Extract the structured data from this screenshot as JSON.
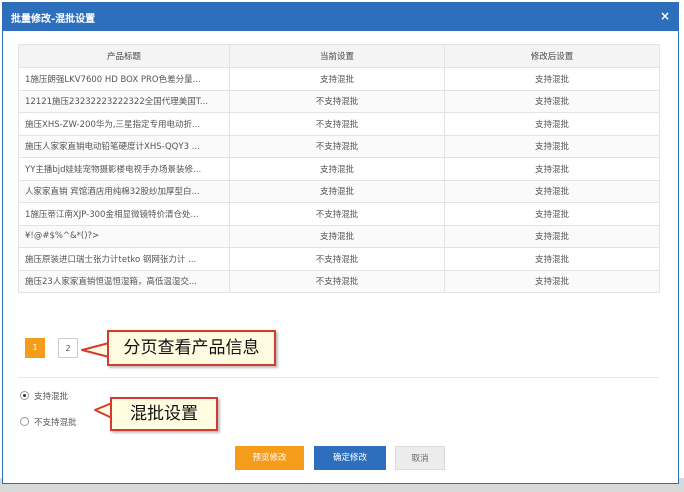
{
  "dialog": {
    "title": "批量修改-混批设置",
    "close_icon": "×"
  },
  "table": {
    "headers": [
      "产品标题",
      "当前设置",
      "修改后设置"
    ],
    "rows": [
      [
        "1施压朗强LKV7600 HD BOX PRO色差分量...",
        "支持混批",
        "支持混批"
      ],
      [
        "12121施压23232223222322全国代理美国T...",
        "不支持混批",
        "支持混批"
      ],
      [
        "施压XHS-ZW-200华为,三星指定专用电动折...",
        "不支持混批",
        "支持混批"
      ],
      [
        "施压人家家直销电动铅笔硬度计XHS-QQY3 ...",
        "不支持混批",
        "支持混批"
      ],
      [
        "YY主播bjd娃娃宠物摄影楼电视手办场景装修...",
        "支持混批",
        "支持混批"
      ],
      [
        "人家家直销 宾馆酒店用纯棉32股纱加厚型白...",
        "支持混批",
        "支持混批"
      ],
      [
        "1施压蒂江南XJP-300金相显微镜特价清仓处...",
        "不支持混批",
        "支持混批"
      ],
      [
        "¥!@#$%^&*()?>",
        "支持混批",
        "支持混批"
      ],
      [
        "施压原装进口瑞士张力计tetko 钢网张力计 ...",
        "不支持混批",
        "支持混批"
      ],
      [
        "施压23人家家直销恒温恒湿箱，高低温湿交...",
        "不支持混批",
        "支持混批"
      ]
    ]
  },
  "pagination": {
    "pages": [
      "1",
      "2"
    ],
    "active": "1"
  },
  "callouts": {
    "pagination_note": "分页查看产品信息",
    "mix_note": "混批设置"
  },
  "options": {
    "support": "支持混批",
    "no_support": "不支持混批",
    "selected": "support"
  },
  "buttons": {
    "preview": "预览修改",
    "confirm": "确定修改",
    "cancel": "取消"
  },
  "colors": {
    "header_blue": "#2d6ebd",
    "accent_orange": "#f59c1a",
    "callout_border": "#d63a2f"
  }
}
